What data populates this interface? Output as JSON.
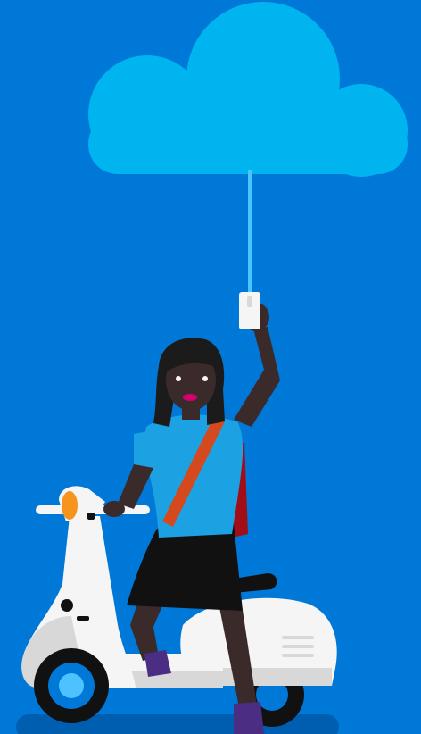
{
  "colors": {
    "background": "#0078D7",
    "cloud": "#00B4EF",
    "cable": "#4CC2FF",
    "skin": "#3B2A2A",
    "hair": "#1B1B1B",
    "shirt": "#1CA1E2",
    "strap": "#D4491E",
    "bag": "#A10E18",
    "skirt": "#111111",
    "scooter_body": "#F5F5F5",
    "scooter_shadow": "#D8D8D8",
    "headlight": "#F7941D",
    "wheel_outer": "#111111",
    "wheel_inner": "#0078D7",
    "wheel_hub": "#4CC2FF",
    "shoe": "#4B2E83",
    "ground_shadow": "#005EB0"
  },
  "icons": [
    "cloud-icon",
    "phone-icon",
    "scooter-icon",
    "person-illustration"
  ]
}
